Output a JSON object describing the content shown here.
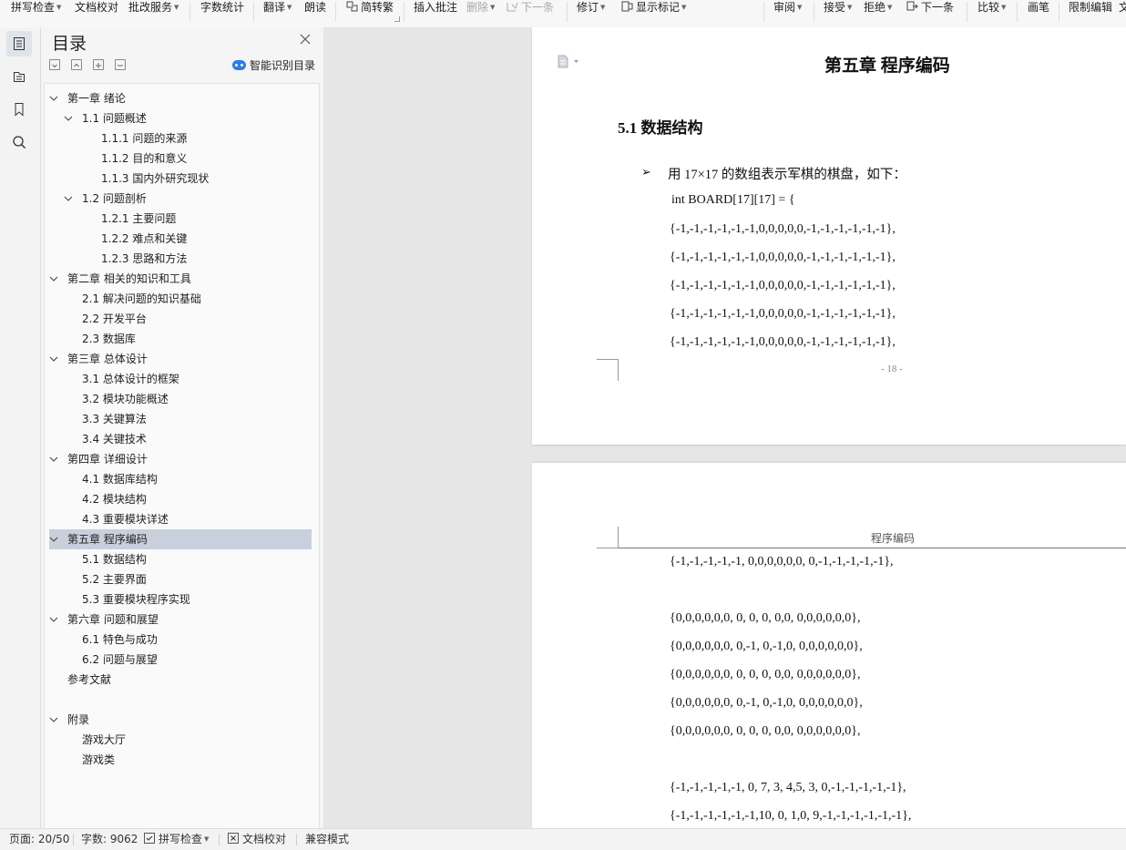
{
  "toolbar": {
    "spell_check": "拼写检查",
    "doc_check": "文档校对",
    "revision_service": "批改服务",
    "word_count": "字数统计",
    "translate": "翻译",
    "read_aloud": "朗读",
    "simp_trad": "简转繁",
    "insert_comment": "插入批注",
    "delete": "删除",
    "next_comment": "下一条",
    "track_changes": "修订",
    "show_markup": "显示标记",
    "review": "审阅",
    "accept": "接受",
    "reject": "拒绝",
    "next_change": "下一条",
    "compare": "比较",
    "ink": "画笔",
    "restrict_edit": "限制编辑",
    "overflow": "文"
  },
  "panel": {
    "title": "目录",
    "smart_toc": "智能识别目录"
  },
  "outline": [
    {
      "text": "第一章  绪论",
      "level": 1,
      "expand": true
    },
    {
      "text": "1.1  问题概述",
      "level": 2,
      "expand": true
    },
    {
      "text": "1.1.1  问题的来源",
      "level": 3,
      "expand": false
    },
    {
      "text": "1.1.2  目的和意义",
      "level": 3,
      "expand": false
    },
    {
      "text": "1.1.3  国内外研究现状",
      "level": 3,
      "expand": false
    },
    {
      "text": "1.2  问题剖析",
      "level": 2,
      "expand": true
    },
    {
      "text": "1.2.1  主要问题",
      "level": 3,
      "expand": false
    },
    {
      "text": "1.2.2  难点和关键",
      "level": 3,
      "expand": false
    },
    {
      "text": "1.2.3  思路和方法",
      "level": 3,
      "expand": false
    },
    {
      "text": "第二章  相关的知识和工具",
      "level": 1,
      "expand": true
    },
    {
      "text": "2.1  解决问题的知识基础",
      "level": 2,
      "expand": false
    },
    {
      "text": "2.2  开发平台",
      "level": 2,
      "expand": false
    },
    {
      "text": "2.3  数据库",
      "level": 2,
      "expand": false
    },
    {
      "text": "第三章  总体设计",
      "level": 1,
      "expand": true
    },
    {
      "text": "3.1  总体设计的框架",
      "level": 2,
      "expand": false
    },
    {
      "text": "3.2  模块功能概述",
      "level": 2,
      "expand": false
    },
    {
      "text": "3.3  关键算法",
      "level": 2,
      "expand": false
    },
    {
      "text": "3.4 关键技术",
      "level": 2,
      "expand": false
    },
    {
      "text": "第四章  详细设计",
      "level": 1,
      "expand": true
    },
    {
      "text": "4.1 数据库结构",
      "level": 2,
      "expand": false
    },
    {
      "text": "4.2 模块结构",
      "level": 2,
      "expand": false
    },
    {
      "text": "4.3  重要模块详述",
      "level": 2,
      "expand": false
    },
    {
      "text": "第五章  程序编码",
      "level": 1,
      "expand": true,
      "selected": true
    },
    {
      "text": "5.1  数据结构",
      "level": 2,
      "expand": false
    },
    {
      "text": "5.2 主要界面",
      "level": 2,
      "expand": false
    },
    {
      "text": "5.3  重要模块程序实现",
      "level": 2,
      "expand": false
    },
    {
      "text": "第六章  问题和展望",
      "level": 1,
      "expand": true
    },
    {
      "text": "6.1  特色与成功",
      "level": 2,
      "expand": false
    },
    {
      "text": "6.2  问题与展望",
      "level": 2,
      "expand": false
    },
    {
      "text": "参考文献",
      "level": 1,
      "expand": false
    },
    {
      "text": "",
      "level": 1,
      "expand": false
    },
    {
      "text": "附录",
      "level": 1,
      "expand": true
    },
    {
      "text": "游戏大厅",
      "level": 2,
      "expand": false
    },
    {
      "text": "游戏类",
      "level": 2,
      "expand": false
    }
  ],
  "doc": {
    "chapter": "第五章  程序编码",
    "section": "5.1  数据结构",
    "bullet": "用 17×17 的数组表示军棋的棋盘，如下：",
    "decl": "int BOARD[17][17] = {",
    "page1_rows": [
      "{-1,-1,-1,-1,-1,-1,0,0,0,0,0,-1,-1,-1,-1,-1,-1},",
      "{-1,-1,-1,-1,-1,-1,0,0,0,0,0,-1,-1,-1,-1,-1,-1},",
      "{-1,-1,-1,-1,-1,-1,0,0,0,0,0,-1,-1,-1,-1,-1,-1},",
      "{-1,-1,-1,-1,-1,-1,0,0,0,0,0,-1,-1,-1,-1,-1,-1},",
      "{-1,-1,-1,-1,-1,-1,0,0,0,0,0,-1,-1,-1,-1,-1,-1},"
    ],
    "page_number": "- 18 -",
    "header": "程序编码",
    "page2_rows": [
      "{-1,-1,-1,-1,-1, 0,0,0,0,0,0, 0,-1,-1,-1,-1,-1},",
      "",
      "{0,0,0,0,0,0, 0, 0, 0, 0,0, 0,0,0,0,0,0},",
      "{0,0,0,0,0,0, 0,-1, 0,-1,0, 0,0,0,0,0,0},",
      "{0,0,0,0,0,0, 0, 0, 0, 0,0, 0,0,0,0,0,0},",
      "{0,0,0,0,0,0, 0,-1, 0,-1,0, 0,0,0,0,0,0},",
      "{0,0,0,0,0,0, 0, 0, 0, 0,0, 0,0,0,0,0,0},",
      "",
      "{-1,-1,-1,-1,-1, 0, 7, 3, 4,5, 3, 0,-1,-1,-1,-1,-1},",
      "{-1,-1,-1,-1,-1,-1,10, 0, 1,0, 9,-1,-1,-1,-1,-1,-1},"
    ]
  },
  "status": {
    "page": "页面: 20/50",
    "words": "字数: 9062",
    "spell": "拼写检查",
    "doc_check": "文档校对",
    "compat": "兼容模式"
  }
}
